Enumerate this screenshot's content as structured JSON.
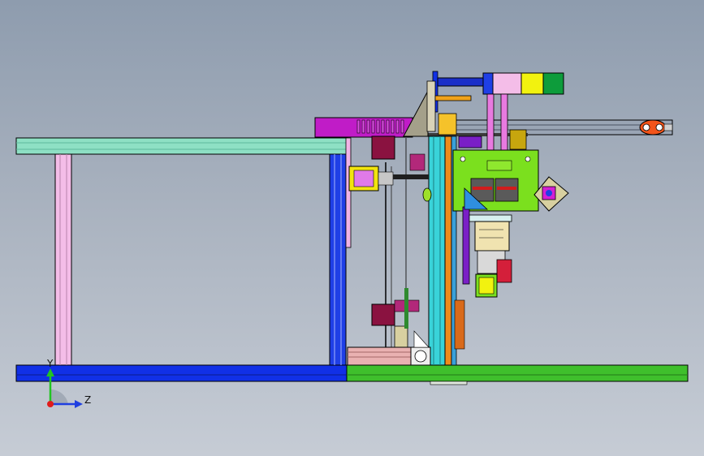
{
  "viewport": {
    "background_top": "#8e9cae",
    "background_bottom": "#c6ccd5"
  },
  "triad": {
    "y_label": "Y",
    "z_label": "Z",
    "y_color": "#22c422",
    "z_color": "#1f3fe0",
    "x_color": "#e01b1b"
  },
  "colors": {
    "frame_left_blue": "#1130e6",
    "frame_right_green": "#3fbf2c",
    "top_beam": "#8ee0c4",
    "pink_post": "#f4bde8",
    "blue_post": "#1f3fe6",
    "magenta_block": "#c01cc7",
    "lime_body": "#7be01e",
    "yellow_cylinder": "#f2f20f",
    "green_cylinder": "#0d9c3b",
    "cyan_column": "#39d3d9",
    "orange_column": "#f08a1a",
    "maroon_gripper": "#8a1240"
  }
}
